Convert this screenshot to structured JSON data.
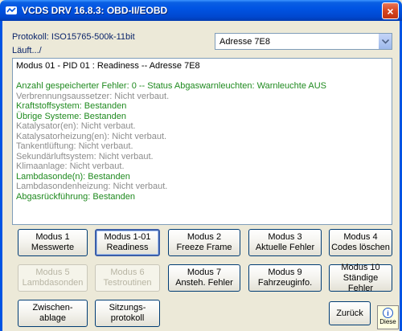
{
  "window": {
    "title": "VCDS DRV 16.8.3:  OBD-II/EOBD",
    "close_glyph": "×"
  },
  "header": {
    "protokoll": "Protokoll: ISO15765-500k-11bit",
    "status": "Läuft.../"
  },
  "address_select": {
    "value": "Adresse 7E8"
  },
  "output_lines": [
    {
      "text": "Modus 01 - PID 01 : Readiness  --  Adresse 7E8",
      "style": "black"
    },
    {
      "text": "",
      "style": "blank"
    },
    {
      "text": "Anzahl gespeicherter Fehler: 0  --  Status Abgaswarnleuchten: Warnleuchte AUS",
      "style": "green"
    },
    {
      "text": "Verbrennungsaussetzer: Nicht verbaut.",
      "style": "gray"
    },
    {
      "text": "Kraftstoffsystem:  Bestanden",
      "style": "green"
    },
    {
      "text": "Übrige Systeme:  Bestanden",
      "style": "green"
    },
    {
      "text": "Katalysator(en): Nicht verbaut.",
      "style": "gray"
    },
    {
      "text": "Katalysatorheizung(en): Nicht verbaut.",
      "style": "gray"
    },
    {
      "text": "Tankentlüftung: Nicht verbaut.",
      "style": "gray"
    },
    {
      "text": "Sekundärluftsystem: Nicht verbaut.",
      "style": "gray"
    },
    {
      "text": "Klimaanlage: Nicht verbaut.",
      "style": "gray"
    },
    {
      "text": "Lambdasonde(n):  Bestanden",
      "style": "green"
    },
    {
      "text": "Lambdasondenheizung: Nicht verbaut.",
      "style": "gray"
    },
    {
      "text": "Abgasrückführung:  Bestanden",
      "style": "green"
    }
  ],
  "buttons": {
    "mode1": {
      "line1": "Modus 1",
      "line2": "Messwerte"
    },
    "mode1_01": {
      "line1": "Modus 1-01",
      "line2": "Readiness"
    },
    "mode2": {
      "line1": "Modus 2",
      "line2": "Freeze Frame"
    },
    "mode3": {
      "line1": "Modus 3",
      "line2": "Aktuelle Fehler"
    },
    "mode4": {
      "line1": "Modus 4",
      "line2": "Codes löschen"
    },
    "mode5": {
      "line1": "Modus 5",
      "line2": "Lambdasonden"
    },
    "mode6": {
      "line1": "Modus 6",
      "line2": "Testroutinen"
    },
    "mode7": {
      "line1": "Modus 7",
      "line2": "Ansteh. Fehler"
    },
    "mode9": {
      "line1": "Modus 9",
      "line2": "Fahrzeuginfo."
    },
    "mode10": {
      "line1": "Modus 10",
      "line2": "Ständige Fehler"
    },
    "clipboard": {
      "line1": "Zwischen-",
      "line2": "ablage"
    },
    "session_log": {
      "line1": "Sitzungs-",
      "line2": "protokoll"
    },
    "back": {
      "line1": "Zurück"
    }
  },
  "status_corner": {
    "label": "Diese"
  },
  "colors": {
    "title_bar": "#0054e3",
    "pass_text": "#1f8a1f",
    "not_installed_text": "#8c8c8c",
    "header_text": "#0a246a"
  }
}
